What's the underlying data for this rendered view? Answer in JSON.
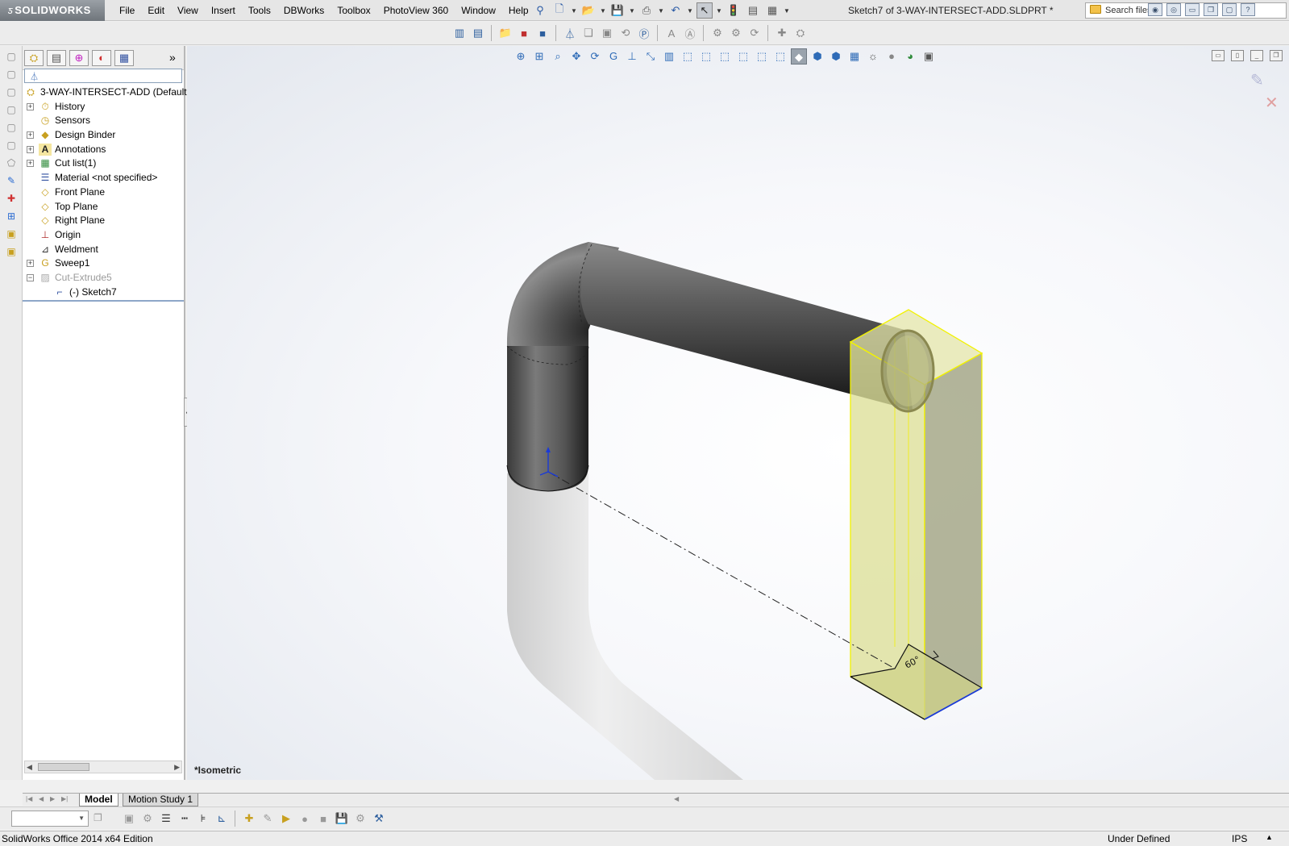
{
  "app": {
    "brand": "SOLIDWORKS",
    "document_title": "Sketch7 of 3-WAY-INTERSECT-ADD.SLDPRT *"
  },
  "menu": [
    "File",
    "Edit",
    "View",
    "Insert",
    "Tools",
    "DBWorks",
    "Toolbox",
    "PhotoView 360",
    "Window",
    "Help"
  ],
  "search": {
    "placeholder": "Search files"
  },
  "feature_tree": {
    "root": "3-WAY-INTERSECT-ADD  (Default",
    "items": [
      {
        "label": "History",
        "icon": "history-icon",
        "expandable": true
      },
      {
        "label": "Sensors",
        "icon": "sensors-icon",
        "expandable": false
      },
      {
        "label": "Design Binder",
        "icon": "design-binder-icon",
        "expandable": true
      },
      {
        "label": "Annotations",
        "icon": "annotations-icon",
        "expandable": true
      },
      {
        "label": "Cut list(1)",
        "icon": "cut-list-icon",
        "expandable": true
      },
      {
        "label": "Material <not specified>",
        "icon": "material-icon",
        "expandable": false
      },
      {
        "label": "Front Plane",
        "icon": "plane-icon",
        "expandable": false
      },
      {
        "label": "Top Plane",
        "icon": "plane-icon",
        "expandable": false
      },
      {
        "label": "Right Plane",
        "icon": "plane-icon",
        "expandable": false
      },
      {
        "label": "Origin",
        "icon": "origin-icon",
        "expandable": false
      },
      {
        "label": "Weldment",
        "icon": "weldment-icon",
        "expandable": false
      },
      {
        "label": "Sweep1",
        "icon": "sweep-icon",
        "expandable": true
      },
      {
        "label": "Cut-Extrude5",
        "icon": "cut-extrude-icon",
        "expandable": true,
        "expanded": true,
        "greyed": true
      }
    ],
    "child": "(-) Sketch7"
  },
  "viewport": {
    "view_label": "*Isometric",
    "dimension": "60°"
  },
  "bottom_tabs": [
    "Model",
    "Motion Study 1"
  ],
  "status": {
    "edition": "SolidWorks Office 2014 x64 Edition",
    "state": "Under Defined",
    "units": "IPS"
  },
  "colors": {
    "selection_yellow": "#ffff00",
    "transparent_body": "#d8dc8c",
    "pipe_dark": "#4a4a4a"
  }
}
